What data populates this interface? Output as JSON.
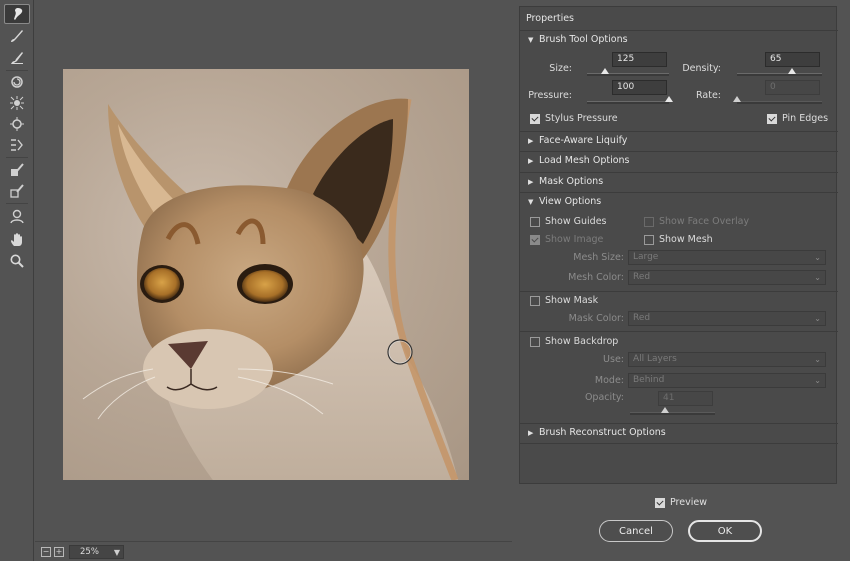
{
  "toolbar": {
    "tools": [
      {
        "name": "forward-warp-icon",
        "active": true
      },
      {
        "name": "reconstruct-icon"
      },
      {
        "name": "smooth-icon"
      },
      {
        "name": "twirl-icon"
      },
      {
        "name": "pucker-icon"
      },
      {
        "name": "bloat-icon"
      },
      {
        "name": "push-left-icon"
      },
      {
        "name": "freeze-mask-icon"
      },
      {
        "name": "thaw-mask-icon"
      },
      {
        "name": "face-tool-icon"
      },
      {
        "name": "hand-icon"
      },
      {
        "name": "zoom-icon"
      }
    ]
  },
  "status": {
    "zoom": "25%",
    "minus": "−",
    "plus": "+"
  },
  "panel": {
    "title": "Properties",
    "brush": {
      "header": "Brush Tool Options",
      "size_label": "Size:",
      "size_value": "125",
      "size": 125,
      "size_max": 15000,
      "density_label": "Density:",
      "density_value": "65",
      "density": 65,
      "pressure_label": "Pressure:",
      "pressure_value": "100",
      "pressure": 100,
      "rate_label": "Rate:",
      "rate_value": "0",
      "rate": 0,
      "stylus_label": "Stylus Pressure",
      "stylus_checked": true,
      "pin_label": "Pin Edges",
      "pin_checked": true
    },
    "sections": {
      "face": "Face-Aware Liquify",
      "load_mesh": "Load Mesh Options",
      "mask": "Mask Options",
      "view": "View Options",
      "reconstruct": "Brush Reconstruct Options"
    },
    "view": {
      "show_guides": "Show Guides",
      "show_face_overlay": "Show Face Overlay",
      "show_image": "Show Image",
      "show_mesh": "Show Mesh",
      "mesh_size_label": "Mesh Size:",
      "mesh_size": "Large",
      "mesh_color_label": "Mesh Color:",
      "mesh_color": "Red",
      "show_mask": "Show Mask",
      "mask_color_label": "Mask Color:",
      "mask_color": "Red",
      "show_backdrop": "Show Backdrop",
      "use_label": "Use:",
      "use": "All Layers",
      "mode_label": "Mode:",
      "mode": "Behind",
      "opacity_label": "Opacity:",
      "opacity_value": "41",
      "opacity": 41
    }
  },
  "footer": {
    "preview": "Preview",
    "preview_checked": true,
    "cancel": "Cancel",
    "ok": "OK"
  },
  "colors": {
    "bg": "#535353",
    "panel": "#4a4a4a",
    "field": "#3e3e3e"
  }
}
